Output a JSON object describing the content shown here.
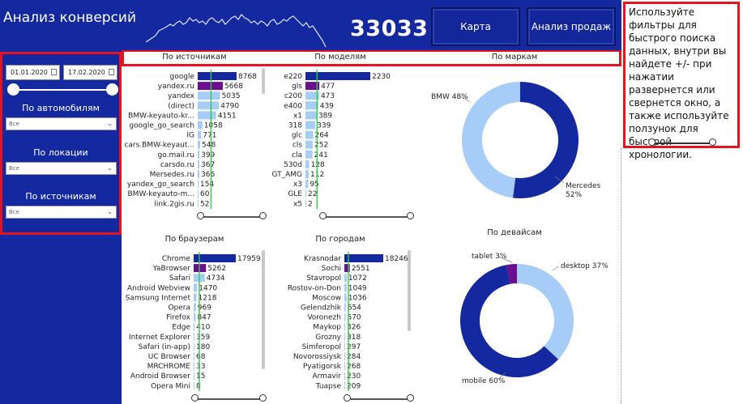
{
  "header": {
    "title": "Анализ конверсий",
    "kpi_value": "33033",
    "buttons": {
      "map": "Карта",
      "sales": "Анализ продаж"
    }
  },
  "sidebar": {
    "date_from": "01.01.2020",
    "date_to": "17.02.2020",
    "filters": [
      {
        "label": "По автомобилям",
        "value": "Все"
      },
      {
        "label": "По локации",
        "value": "Все"
      },
      {
        "label": "По источникам",
        "value": "Все"
      }
    ]
  },
  "section_titles": {
    "sources": "По источникам",
    "models": "По моделям",
    "brands": "По маркам",
    "browsers": "По браузерам",
    "cities": "По городам",
    "devices": "По девайсам"
  },
  "info_text": "Используйте фильтры для быстрого поиска данных, внутри вы найдете +/- при нажатии развернется или свернется окно, а также используйте ползунок для быстрой хронологии.",
  "colors": {
    "primary": "#1428a0",
    "purple": "#6a0f8e",
    "light": "#a6cdf8",
    "accent": "#e3141f",
    "line": "#2ecc40"
  },
  "chart_data": [
    {
      "type": "bar",
      "title": "По источникам",
      "categories": [
        "google",
        "yandex.ru",
        "yandex",
        "(direct)",
        "BMW-keyauto-kr...",
        "google_go_search",
        "IG",
        "cars.BMW-keyaut...",
        "go.mail.ru",
        "carsdo.ru",
        "Mersedes.ru",
        "yandex_go_search",
        "BMW-keyauto-m...",
        "link.2gis.ru"
      ],
      "values": [
        8768,
        5668,
        5035,
        4790,
        4151,
        1058,
        771,
        548,
        399,
        367,
        366,
        154,
        60,
        52
      ],
      "labels": [
        "8768",
        "5668",
        "5035",
        "4790",
        "4151",
        "1058",
        "771",
        "548",
        "399",
        "367",
        "366",
        "154",
        "60",
        "52"
      ],
      "colors": [
        "#1428a0",
        "#6a0f8e",
        "#a6cdf8",
        "#a6cdf8",
        "#a6cdf8",
        "#a6cdf8",
        "#a6cdf8",
        "#a6cdf8",
        "#a6cdf8",
        "#a6cdf8",
        "#a6cdf8",
        "#a6cdf8",
        "#a6cdf8",
        "#a6cdf8"
      ],
      "reference_line": 3000
    },
    {
      "type": "bar",
      "title": "По моделям",
      "categories": [
        "e220",
        "gls",
        "c200",
        "e400",
        "x1",
        "318",
        "glc",
        "cls",
        "cla",
        "530d",
        "GT_AMG",
        "x3",
        "GLE",
        "x5"
      ],
      "values": [
        2230,
        477,
        473,
        439,
        389,
        339,
        264,
        252,
        241,
        128,
        112,
        95,
        22,
        2
      ],
      "labels": [
        "2230",
        "477",
        "473",
        "439",
        "389",
        "339",
        "264",
        "252",
        "241",
        "128",
        "112",
        "95",
        "22",
        "2"
      ],
      "colors": [
        "#1428a0",
        "#6a0f8e",
        "#a6cdf8",
        "#a6cdf8",
        "#a6cdf8",
        "#a6cdf8",
        "#a6cdf8",
        "#a6cdf8",
        "#a6cdf8",
        "#a6cdf8",
        "#a6cdf8",
        "#a6cdf8",
        "#a6cdf8",
        "#a6cdf8"
      ],
      "reference_line": 400
    },
    {
      "type": "bar",
      "title": "По браузерам",
      "categories": [
        "Chrome",
        "YaBrowser",
        "Safari",
        "Android Webview",
        "Samsung Internet",
        "Opera",
        "Firefox",
        "Edge",
        "Internet Explorer",
        "Safari (in-app)",
        "UC Browser",
        "MRCHROME",
        "Android Browser",
        "Opera Mini"
      ],
      "values": [
        17959,
        5262,
        4734,
        1470,
        1218,
        969,
        847,
        410,
        359,
        180,
        68,
        33,
        15,
        8
      ],
      "labels": [
        "17959",
        "5262",
        "4734",
        "1470",
        "1218",
        "969",
        "847",
        "410",
        "359",
        "180",
        "68",
        "33",
        "15",
        "8"
      ],
      "colors": [
        "#1428a0",
        "#6a0f8e",
        "#a6cdf8",
        "#a6cdf8",
        "#a6cdf8",
        "#a6cdf8",
        "#a6cdf8",
        "#a6cdf8",
        "#a6cdf8",
        "#a6cdf8",
        "#a6cdf8",
        "#a6cdf8",
        "#a6cdf8",
        "#a6cdf8"
      ],
      "reference_line": 2400
    },
    {
      "type": "bar",
      "title": "По городам",
      "categories": [
        "Krasnodar",
        "Sochi",
        "Stavropol",
        "Rostov-on-Don",
        "Moscow",
        "Gelendzhik",
        "Voronezh",
        "Maykop",
        "Grozny",
        "Simferopol",
        "Novorossiysk",
        "Pyatigorsk",
        "Armavir",
        "Tuapse"
      ],
      "values": [
        18246,
        2551,
        1072,
        1049,
        1036,
        654,
        570,
        326,
        318,
        297,
        284,
        268,
        230,
        209
      ],
      "labels": [
        "18246",
        "2551",
        "1072",
        "1049",
        "1036",
        "654",
        "570",
        "326",
        "318",
        "297",
        "284",
        "268",
        "230",
        "209"
      ],
      "colors": [
        "#1428a0",
        "#6a0f8e",
        "#a6cdf8",
        "#a6cdf8",
        "#a6cdf8",
        "#a6cdf8",
        "#a6cdf8",
        "#a6cdf8",
        "#a6cdf8",
        "#a6cdf8",
        "#a6cdf8",
        "#a6cdf8",
        "#a6cdf8",
        "#a6cdf8"
      ],
      "reference_line": 1900
    },
    {
      "type": "pie",
      "title": "По маркам",
      "categories": [
        "Mercedes",
        "BMW"
      ],
      "values": [
        52,
        48
      ],
      "labels": [
        "Mercedes\n52%",
        "BMW 48%"
      ],
      "colors": [
        "#1428a0",
        "#a6cdf8"
      ]
    },
    {
      "type": "pie",
      "title": "По девайсам",
      "categories": [
        "desktop",
        "mobile",
        "tablet"
      ],
      "values": [
        37,
        60,
        3
      ],
      "labels": [
        "desktop 37%",
        "mobile 60%",
        "tablet 3%"
      ],
      "colors": [
        "#a6cdf8",
        "#1428a0",
        "#6a0f8e"
      ]
    }
  ]
}
